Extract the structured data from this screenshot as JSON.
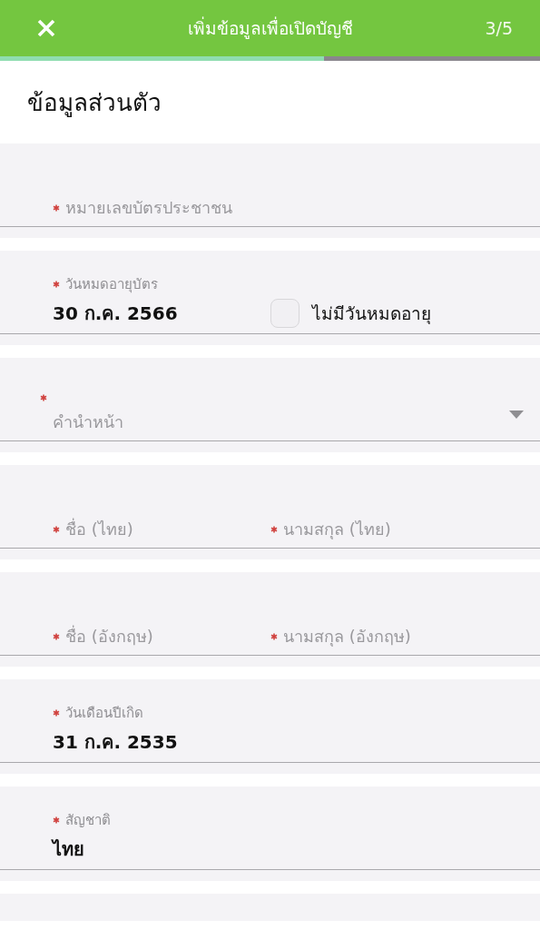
{
  "header": {
    "title": "เพิ่มข้อมูลเพื่อเปิดบัญชี",
    "step": "3/5",
    "progress": {
      "level": 0.6
    }
  },
  "section_title": "ข้อมูลส่วนตัว",
  "fields": [
    {
      "kind": "text",
      "required": true,
      "placeholder": "หมายเลขบัตรประชาชน"
    },
    {
      "kind": "date-check",
      "required": true,
      "label": "วันหมดอายุบัตร",
      "value": "30 ก.ค. 2566",
      "checkbox": {
        "label": "ไม่มีวันหมดอายุ",
        "checked": false
      }
    },
    {
      "kind": "select",
      "required": true,
      "placeholder": "คำนำหน้า"
    },
    {
      "kind": "pair",
      "parts": [
        {
          "required": true,
          "placeholder": "ชื่อ (ไทย)"
        },
        {
          "required": true,
          "placeholder": "นามสกุล (ไทย)"
        }
      ]
    },
    {
      "kind": "pair",
      "parts": [
        {
          "required": true,
          "placeholder": "ชื่อ (อังกฤษ)"
        },
        {
          "required": true,
          "placeholder": "นามสกุล (อังกฤษ)"
        }
      ]
    },
    {
      "kind": "value",
      "required": true,
      "label": "วันเดือนปีเกิด",
      "value": "31 ก.ค. 2535"
    },
    {
      "kind": "value",
      "required": true,
      "label": "สัญชาติ",
      "value": "ไทย"
    }
  ]
}
